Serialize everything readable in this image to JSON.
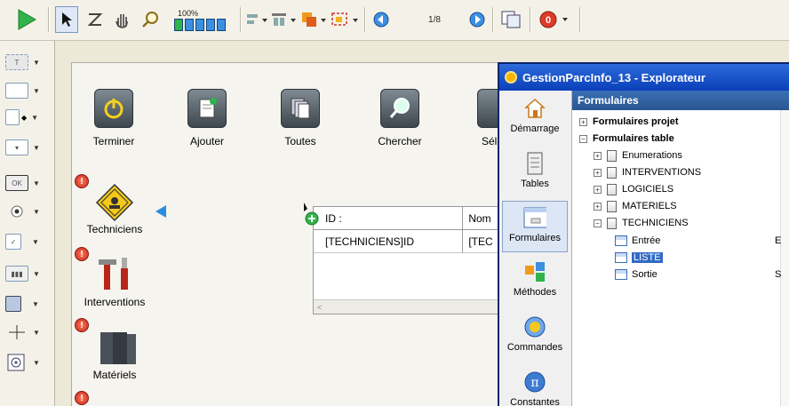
{
  "toolbar": {
    "zoom_label": "100%",
    "page_indicator": "1/8"
  },
  "palette": {
    "items": [
      "T",
      "",
      "",
      "",
      "OK",
      "",
      "",
      "",
      "",
      "",
      ""
    ]
  },
  "form": {
    "buttons": [
      {
        "label": "Terminer"
      },
      {
        "label": "Ajouter"
      },
      {
        "label": "Toutes"
      },
      {
        "label": "Chercher"
      },
      {
        "label": "Sélec"
      }
    ],
    "nav": [
      {
        "label": "Techniciens"
      },
      {
        "label": "Interventions"
      },
      {
        "label": "Matériels"
      }
    ],
    "listbox": {
      "headers": [
        "ID :",
        "Nom"
      ],
      "rows": [
        [
          "[TECHNICIENS]ID",
          "[TEC"
        ]
      ]
    }
  },
  "explorer": {
    "title": "GestionParcInfo_13 - Explorateur",
    "header": "Formulaires",
    "sidebar": [
      "Démarrage",
      "Tables",
      "Formulaires",
      "Méthodes",
      "Commandes",
      "Constantes"
    ],
    "tree": {
      "projet": "Formulaires projet",
      "table": "Formulaires table",
      "tables": [
        "Enumerations",
        "INTERVENTIONS",
        "LOGICIELS",
        "MATERIELS",
        "TECHNICIENS"
      ],
      "forms": [
        {
          "name": "Entrée",
          "flag": "E"
        },
        {
          "name": "LISTE",
          "flag": ""
        },
        {
          "name": "Sortie",
          "flag": "S"
        }
      ]
    }
  },
  "colors": {
    "title_bar": "#0a3fb8",
    "selection": "#316ac5",
    "play_green": "#2fb34a"
  }
}
